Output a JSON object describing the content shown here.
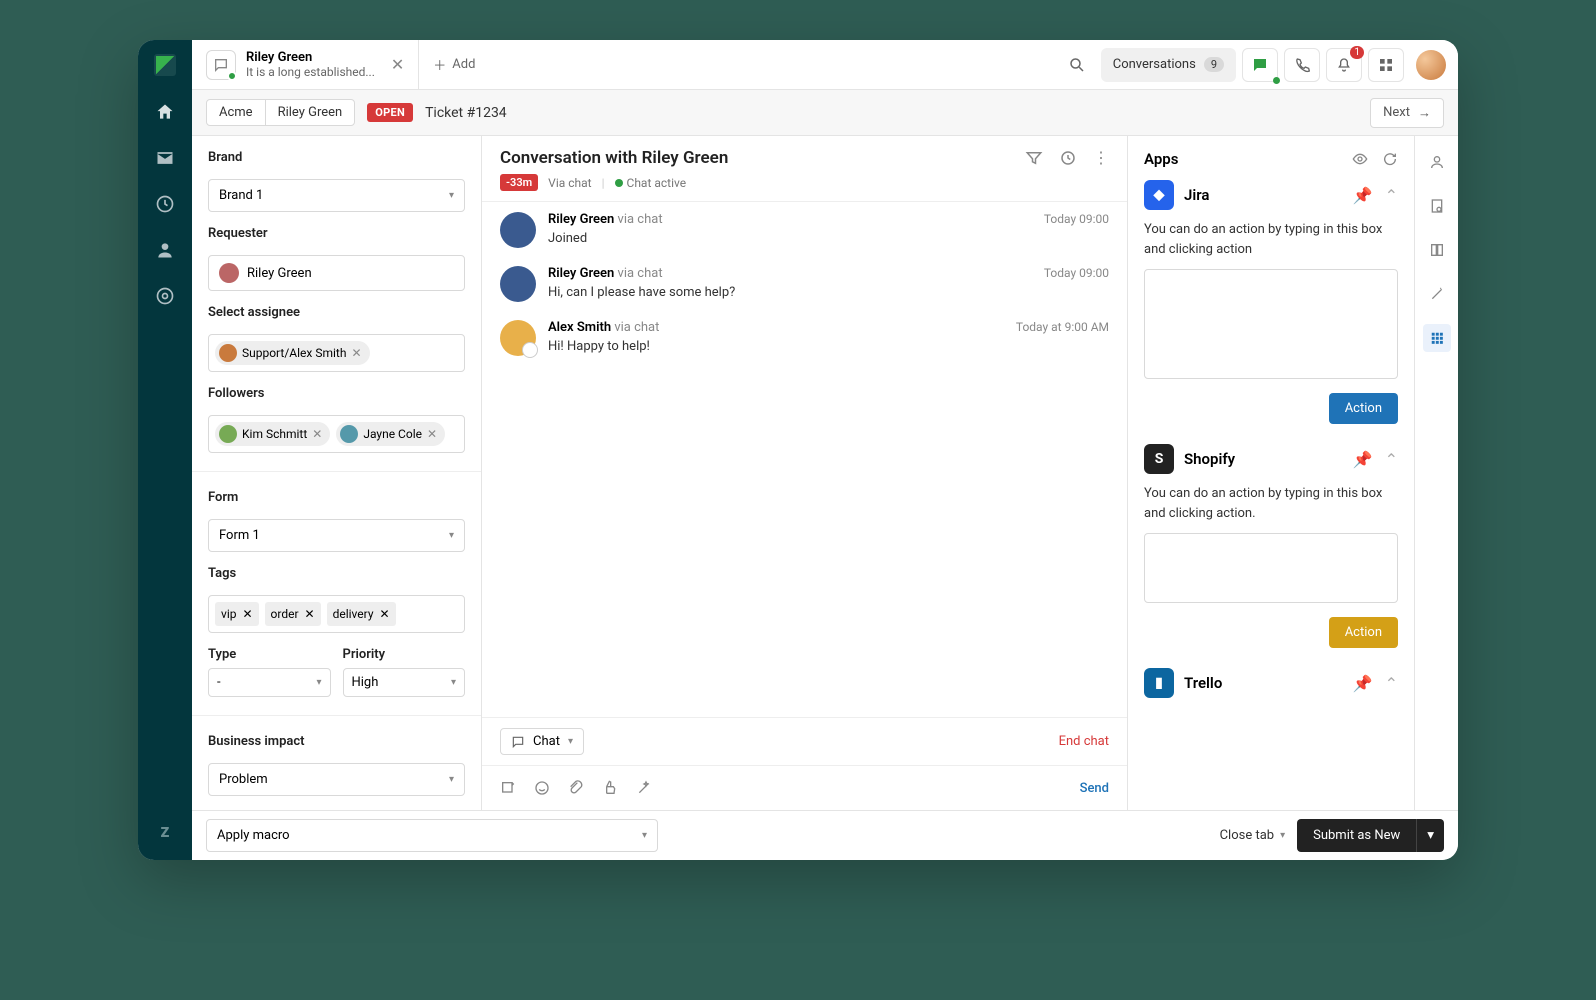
{
  "tab": {
    "title": "Riley Green",
    "subtitle": "It is a long established...",
    "add_label": "Add"
  },
  "topbar": {
    "conversations_label": "Conversations",
    "conversations_count": "9",
    "bell_badge": "1"
  },
  "breadcrumb": {
    "org": "Acme",
    "person": "Riley Green",
    "status": "OPEN",
    "ticket": "Ticket #1234",
    "next": "Next"
  },
  "left": {
    "brand_label": "Brand",
    "brand_value": "Brand 1",
    "requester_label": "Requester",
    "requester_value": "Riley Green",
    "assignee_label": "Select assignee",
    "assignee_value": "Support/Alex Smith",
    "followers_label": "Followers",
    "follower1": "Kim Schmitt",
    "follower2": "Jayne Cole",
    "form_label": "Form",
    "form_value": "Form 1",
    "tags_label": "Tags",
    "tag1": "vip",
    "tag2": "order",
    "tag3": "delivery",
    "type_label": "Type",
    "type_value": "-",
    "priority_label": "Priority",
    "priority_value": "High",
    "impact_label": "Business impact",
    "impact_value": "Problem"
  },
  "conv": {
    "title": "Conversation with Riley Green",
    "time_badge": "-33m",
    "via": "Via chat",
    "status": "Chat active",
    "msgs": [
      {
        "name": "Riley Green",
        "via": "via chat",
        "time": "Today 09:00",
        "text": "Joined"
      },
      {
        "name": "Riley Green",
        "via": "via chat",
        "time": "Today 09:00",
        "text": "Hi, can I please have some help?"
      },
      {
        "name": "Alex Smith",
        "via": "via chat",
        "time": "Today at 9:00 AM",
        "text": "Hi! Happy to help!"
      }
    ],
    "chat_drop": "Chat",
    "end_chat": "End chat",
    "send": "Send"
  },
  "apps": {
    "heading": "Apps",
    "jira": {
      "name": "Jira",
      "desc": "You can do an action by typing in this box and clicking action",
      "btn": "Action"
    },
    "shopify": {
      "name": "Shopify",
      "desc": "You can do an action by typing in this box and clicking action.",
      "btn": "Action"
    },
    "trello": {
      "name": "Trello"
    }
  },
  "footer": {
    "macro": "Apply macro",
    "close": "Close tab",
    "submit": "Submit as New"
  }
}
